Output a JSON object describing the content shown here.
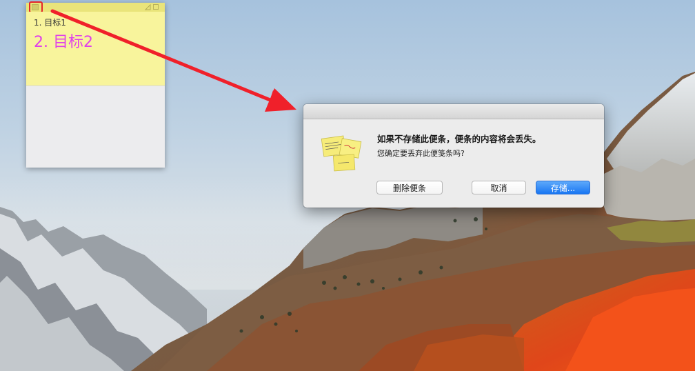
{
  "sticky_note": {
    "line1": "1. 目标1",
    "line2": "2. 目标2",
    "colors": {
      "note_yellow": "#f8f49c",
      "titlebar_yellow": "#e9e47a",
      "line2_text": "#e040ea",
      "highlight": "#e3242b"
    }
  },
  "dialog": {
    "message": "如果不存储此便条，便条的内容将会丢失。",
    "informative_text": "您确定要丢弃此便笺条吗?",
    "icon": "stickies-app-icon",
    "buttons": {
      "delete": "删除便条",
      "cancel": "取消",
      "save": "存储..."
    },
    "colors": {
      "default_button": "#1876f2"
    }
  },
  "annotation": {
    "arrow_color": "#f0202a",
    "icon": "arrow-icon"
  }
}
